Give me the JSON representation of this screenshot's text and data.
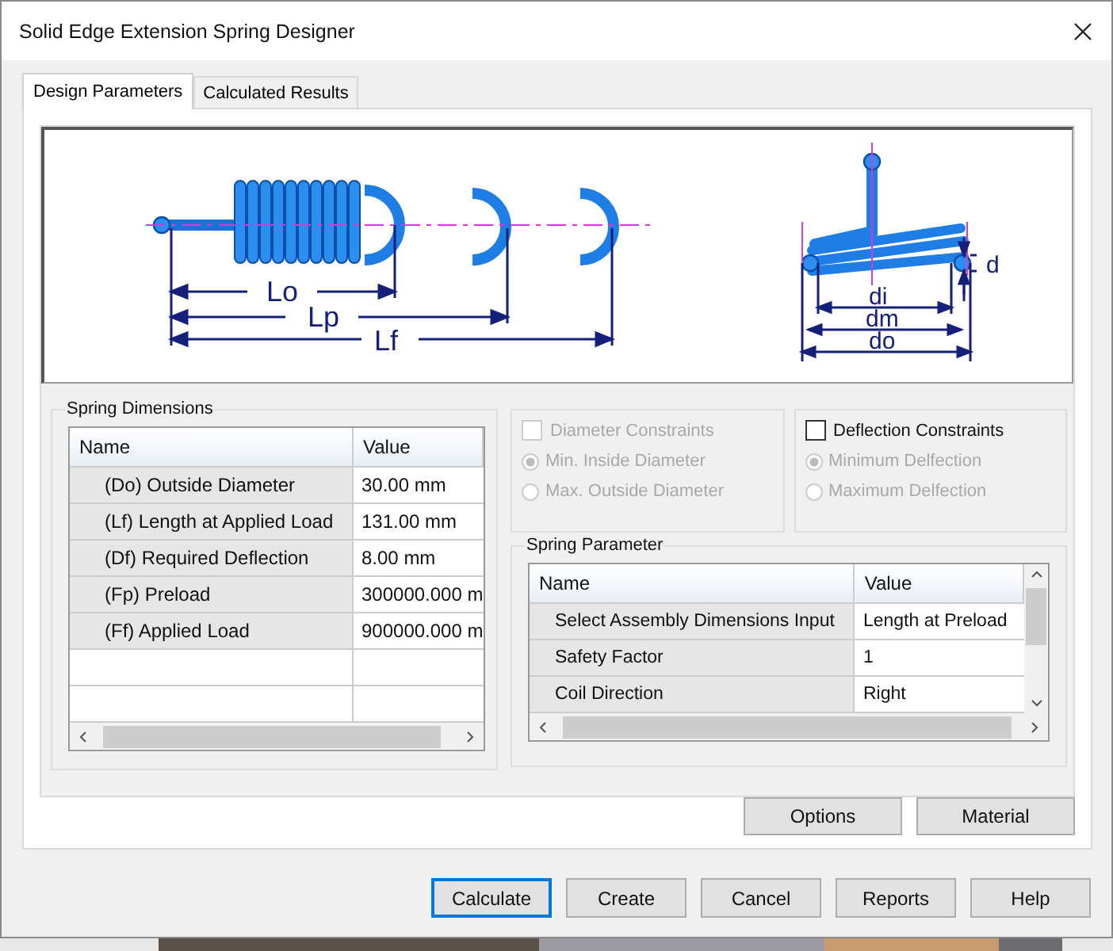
{
  "window": {
    "title": "Solid Edge Extension Spring Designer"
  },
  "tabs": [
    {
      "label": "Design Parameters",
      "selected": true
    },
    {
      "label": "Calculated Results",
      "selected": false
    }
  ],
  "diagram": {
    "labels": [
      "Lo",
      "Lp",
      "Lf",
      "di",
      "dm",
      "do",
      "d"
    ]
  },
  "spring_dimensions": {
    "title": "Spring Dimensions",
    "columns": [
      "Name",
      "Value"
    ],
    "rows": [
      {
        "name": "(Do) Outside Diameter",
        "value": "30.00 mm"
      },
      {
        "name": "(Lf) Length at Applied Load",
        "value": "131.00 mm"
      },
      {
        "name": "(Df) Required Deflection",
        "value": "8.00 mm"
      },
      {
        "name": "(Fp) Preload",
        "value": "300000.000 m"
      },
      {
        "name": "(Ff) Applied Load",
        "value": "900000.000 m"
      }
    ]
  },
  "constraint_groups": [
    {
      "label": "Diameter Constraints",
      "checked": false,
      "disabled": true,
      "options": [
        {
          "label": "Min. Inside Diameter",
          "selected": true,
          "disabled": true
        },
        {
          "label": "Max. Outside Diameter",
          "selected": false,
          "disabled": true
        }
      ]
    },
    {
      "label": "Deflection Constraints",
      "checked": false,
      "disabled": false,
      "options": [
        {
          "label": "Minimum Delfection",
          "selected": true,
          "disabled": true
        },
        {
          "label": "Maximum Delfection",
          "selected": false,
          "disabled": true
        }
      ]
    }
  ],
  "spring_parameter": {
    "title": "Spring Parameter",
    "columns": [
      "Name",
      "Value"
    ],
    "rows": [
      {
        "name": "Select Assembly Dimensions Input",
        "value": "Length at Preload"
      },
      {
        "name": "Safety Factor",
        "value": "1"
      },
      {
        "name": "Coil Direction",
        "value": "Right"
      }
    ]
  },
  "side_buttons": [
    "Options",
    "Material"
  ],
  "buttons": [
    {
      "label": "Calculate",
      "focused": true
    },
    {
      "label": "Create",
      "focused": false
    },
    {
      "label": "Cancel",
      "focused": false
    },
    {
      "label": "Reports",
      "focused": false
    },
    {
      "label": "Help",
      "focused": false
    }
  ]
}
